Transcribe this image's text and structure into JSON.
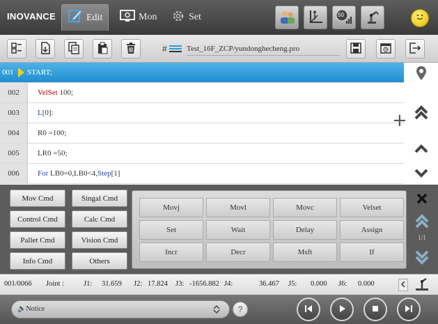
{
  "app": {
    "logo": "INOVANCE"
  },
  "tabs": [
    {
      "label": "Edit",
      "icon": "edit-icon",
      "active": true
    },
    {
      "label": "Mon",
      "icon": "monitor-icon",
      "active": false
    },
    {
      "label": "Set",
      "icon": "gear-icon",
      "active": false
    }
  ],
  "top_buttons": [
    "user-switch-icon",
    "coordinate-axes-icon",
    "speed-50-icon",
    "robot-arm-icon",
    "smiley-icon"
  ],
  "speed_value": "50",
  "toolbar": {
    "icons": [
      "select-all-icon",
      "insert-icon",
      "copy-icon",
      "paste-icon",
      "delete-icon",
      "list-icon",
      "save-icon",
      "schedule-icon",
      "exit-icon"
    ],
    "file_path": "Test_16F_ZCP/yundonghecheng.pro"
  },
  "code_lines": [
    {
      "num": "001",
      "parts": [
        {
          "t": "START;",
          "c": ""
        }
      ],
      "selected": true
    },
    {
      "num": "002",
      "parts": [
        {
          "t": "VelSet",
          "c": "kw"
        },
        {
          "t": " 100;",
          "c": ""
        }
      ]
    },
    {
      "num": "003",
      "parts": [
        {
          "t": "L",
          "c": "kb"
        },
        {
          "t": "[0]:",
          "c": ""
        }
      ]
    },
    {
      "num": "004",
      "parts": [
        {
          "t": "R0 =100;",
          "c": ""
        }
      ]
    },
    {
      "num": "005",
      "parts": [
        {
          "t": "LR0 =50;",
          "c": ""
        }
      ]
    },
    {
      "num": "006",
      "parts": [
        {
          "t": "For",
          "c": "kb"
        },
        {
          "t": " LB0=0,LB0<4,",
          "c": ""
        },
        {
          "t": "Step",
          "c": "kb"
        },
        {
          "t": "[1]",
          "c": ""
        }
      ]
    }
  ],
  "categories": [
    "Mov Cmd",
    "Singal Cmd",
    "Control Cmd",
    "Calc Cmd",
    "Pallet Cmd",
    "Vision Cmd",
    "Info Cmd",
    "Others"
  ],
  "commands": [
    "Movj",
    "Movl",
    "Movc",
    "Velset",
    "Set",
    "Wait",
    "Delay",
    "Assign",
    "Incr",
    "Decr",
    "Msft",
    "If"
  ],
  "page_indicator": "1/1",
  "status": {
    "line": "001/0066",
    "joint_label": "Joint :",
    "j1_label": "J1:",
    "j1": "31.659",
    "j2_label": "J2:",
    "j2": "17.824",
    "j3_label": "J3:",
    "j3": "-1656.882",
    "j4_label": "J4:",
    "j4": "36.467",
    "j5_label": "J5:",
    "j5": "0.000",
    "j6_label": "J6:",
    "j6": "0.000"
  },
  "notice": {
    "label": "Notice"
  },
  "colors": {
    "selected_row": "#1f8ecf",
    "keyword_red": "#b00000",
    "keyword_blue": "#1a3ebf",
    "pointer": "#f5d000"
  }
}
